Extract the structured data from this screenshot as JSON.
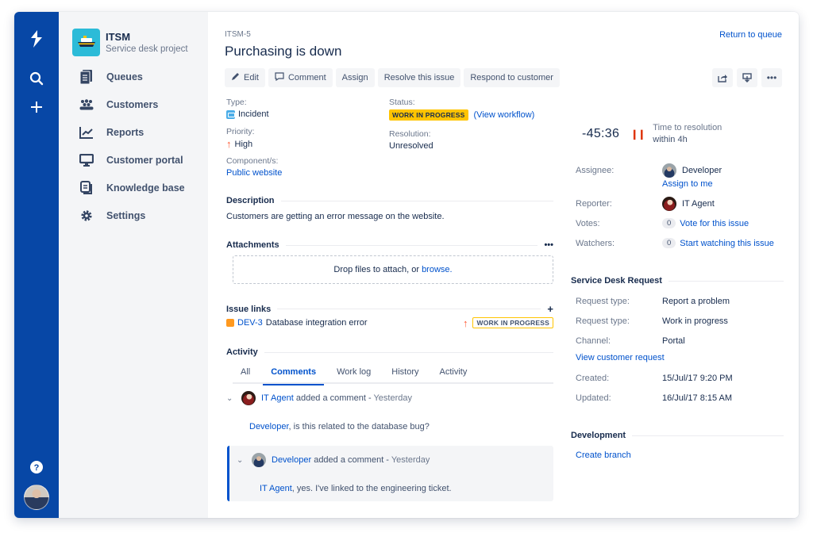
{
  "global_nav": {
    "icons": [
      "jira-service-desk-logo-icon",
      "search-icon",
      "create-icon",
      "help-icon"
    ],
    "avatar": "user-avatar"
  },
  "project": {
    "name": "ITSM",
    "type": "Service desk project",
    "avatar_icon": "ship-icon",
    "avatar_color": "#2cbbd8"
  },
  "sidebar": {
    "items": [
      {
        "label": "Queues",
        "icon": "queues-icon"
      },
      {
        "label": "Customers",
        "icon": "customers-icon"
      },
      {
        "label": "Reports",
        "icon": "reports-icon"
      },
      {
        "label": "Customer portal",
        "icon": "customer-portal-icon"
      },
      {
        "label": "Knowledge base",
        "icon": "knowledge-base-icon"
      },
      {
        "label": "Settings",
        "icon": "gear-icon"
      }
    ]
  },
  "issue": {
    "key": "ITSM-5",
    "title": "Purchasing is down",
    "return_link": "Return to queue"
  },
  "toolbar": {
    "edit": "Edit",
    "comment": "Comment",
    "assign": "Assign",
    "resolve": "Resolve this issue",
    "respond": "Respond to customer",
    "right_icons": [
      "share-icon",
      "export-icon",
      "more-icon"
    ]
  },
  "details": {
    "type_label": "Type:",
    "type_value": "Incident",
    "priority_label": "Priority:",
    "priority_value": "High",
    "component_label": "Component/s:",
    "component_value": "Public website",
    "status_label": "Status:",
    "status_value": "WORK IN PROGRESS",
    "view_workflow": "(View workflow)",
    "resolution_label": "Resolution:",
    "resolution_value": "Unresolved"
  },
  "description": {
    "heading": "Description",
    "text": "Customers are getting an error message on the website."
  },
  "attachments": {
    "heading": "Attachments",
    "more": "•••",
    "drop_text": "Drop files to attach, or ",
    "browse": "browse."
  },
  "issue_links": {
    "heading": "Issue links",
    "add": "+",
    "items": [
      {
        "key": "DEV-3",
        "summary": "Database integration error",
        "status": "WORK IN PROGRESS"
      }
    ]
  },
  "activity": {
    "heading": "Activity",
    "tabs": [
      "All",
      "Comments",
      "Work log",
      "History",
      "Activity"
    ],
    "active_tab": "Comments",
    "comments": [
      {
        "author": "IT Agent",
        "action": " added a comment - ",
        "time": "Yesterday",
        "mention": "Developer",
        "body": ", is this related to the database bug?"
      },
      {
        "author": "Developer",
        "action": " added a comment - ",
        "time": "Yesterday",
        "mention": "IT Agent",
        "body": ", yes. I've linked to the engineering ticket."
      }
    ]
  },
  "sla": {
    "time": "-45:36",
    "label": "Time to resolution",
    "goal": "within 4h",
    "status_color": "#de350b"
  },
  "people": {
    "assignee_label": "Assignee:",
    "assignee": "Developer",
    "assign_to_me": "Assign to me",
    "reporter_label": "Reporter:",
    "reporter": "IT Agent",
    "votes_label": "Votes:",
    "votes": "0",
    "vote_link": "Vote for this issue",
    "watchers_label": "Watchers:",
    "watchers": "0",
    "watch_link": "Start watching this issue"
  },
  "service_desk": {
    "heading": "Service Desk Request",
    "rows": [
      {
        "label": "Request type:",
        "value": "Report a problem"
      },
      {
        "label": "Request type:",
        "value": "Work in progress"
      },
      {
        "label": "Channel:",
        "value": "Portal"
      }
    ],
    "view_request": "View customer request",
    "created_label": "Created:",
    "created": "15/Jul/17 9:20 PM",
    "updated_label": "Updated:",
    "updated": "16/Jul/17 8:15 AM"
  },
  "development": {
    "heading": "Development",
    "create_branch": "Create branch"
  },
  "colors": {
    "nav_blue": "#0747a6",
    "link_blue": "#0052cc",
    "wip_yellow": "#ffc400"
  }
}
